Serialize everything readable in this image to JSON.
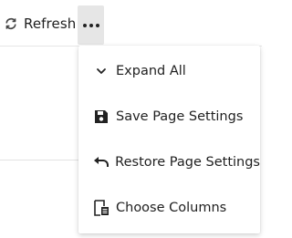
{
  "toolbar": {
    "refresh_label": "Refresh",
    "refresh_icon": "refresh-icon",
    "more_icon": "more-horizontal-icon"
  },
  "menu": {
    "items": [
      {
        "label": "Expand All",
        "icon": "chevron-down-icon"
      },
      {
        "label": "Save Page Settings",
        "icon": "save-icon"
      },
      {
        "label": "Restore Page Settings",
        "icon": "undo-icon"
      },
      {
        "label": "Choose Columns",
        "icon": "choose-columns-icon"
      }
    ]
  },
  "colors": {
    "text": "#1f1f1f",
    "active_button_bg": "#e6e6e6",
    "menu_bg": "#ffffff"
  }
}
